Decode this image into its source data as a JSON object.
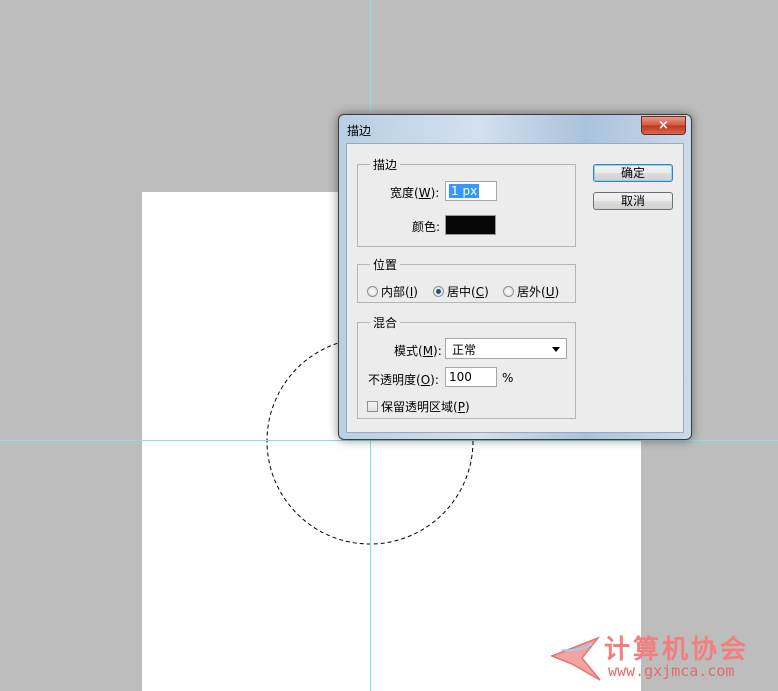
{
  "colors": {
    "canvas_bg": "#bdbdbd",
    "document": "#ffffff",
    "guide": "#7fe4e4",
    "stroke_color": "#060606"
  },
  "dialog": {
    "title": "描边",
    "close_symbol": "×",
    "stroke_group": {
      "legend": "描边",
      "width_label": "宽度(",
      "width_key": "W",
      "width_tail": "):",
      "width_value": "1 px",
      "color_label": "颜色:"
    },
    "position_group": {
      "legend": "位置",
      "options": [
        {
          "label": "内部(",
          "key": "I",
          "tail": ")",
          "selected": false
        },
        {
          "label": "居中(",
          "key": "C",
          "tail": ")",
          "selected": true
        },
        {
          "label": "居外(",
          "key": "U",
          "tail": ")",
          "selected": false
        }
      ]
    },
    "blend_group": {
      "legend": "混合",
      "mode_label": "模式(",
      "mode_key": "M",
      "mode_tail": "):",
      "mode_value": "正常",
      "opacity_label": "不透明度(",
      "opacity_key": "O",
      "opacity_tail": "):",
      "opacity_value": "100",
      "opacity_unit": "%",
      "preserve_label": "保留透明区域(",
      "preserve_key": "P",
      "preserve_tail": ")"
    },
    "ok_label": "确定",
    "cancel_label": "取消"
  },
  "watermark": {
    "title": "计算机协会",
    "url": "www.gxjmca.com"
  }
}
